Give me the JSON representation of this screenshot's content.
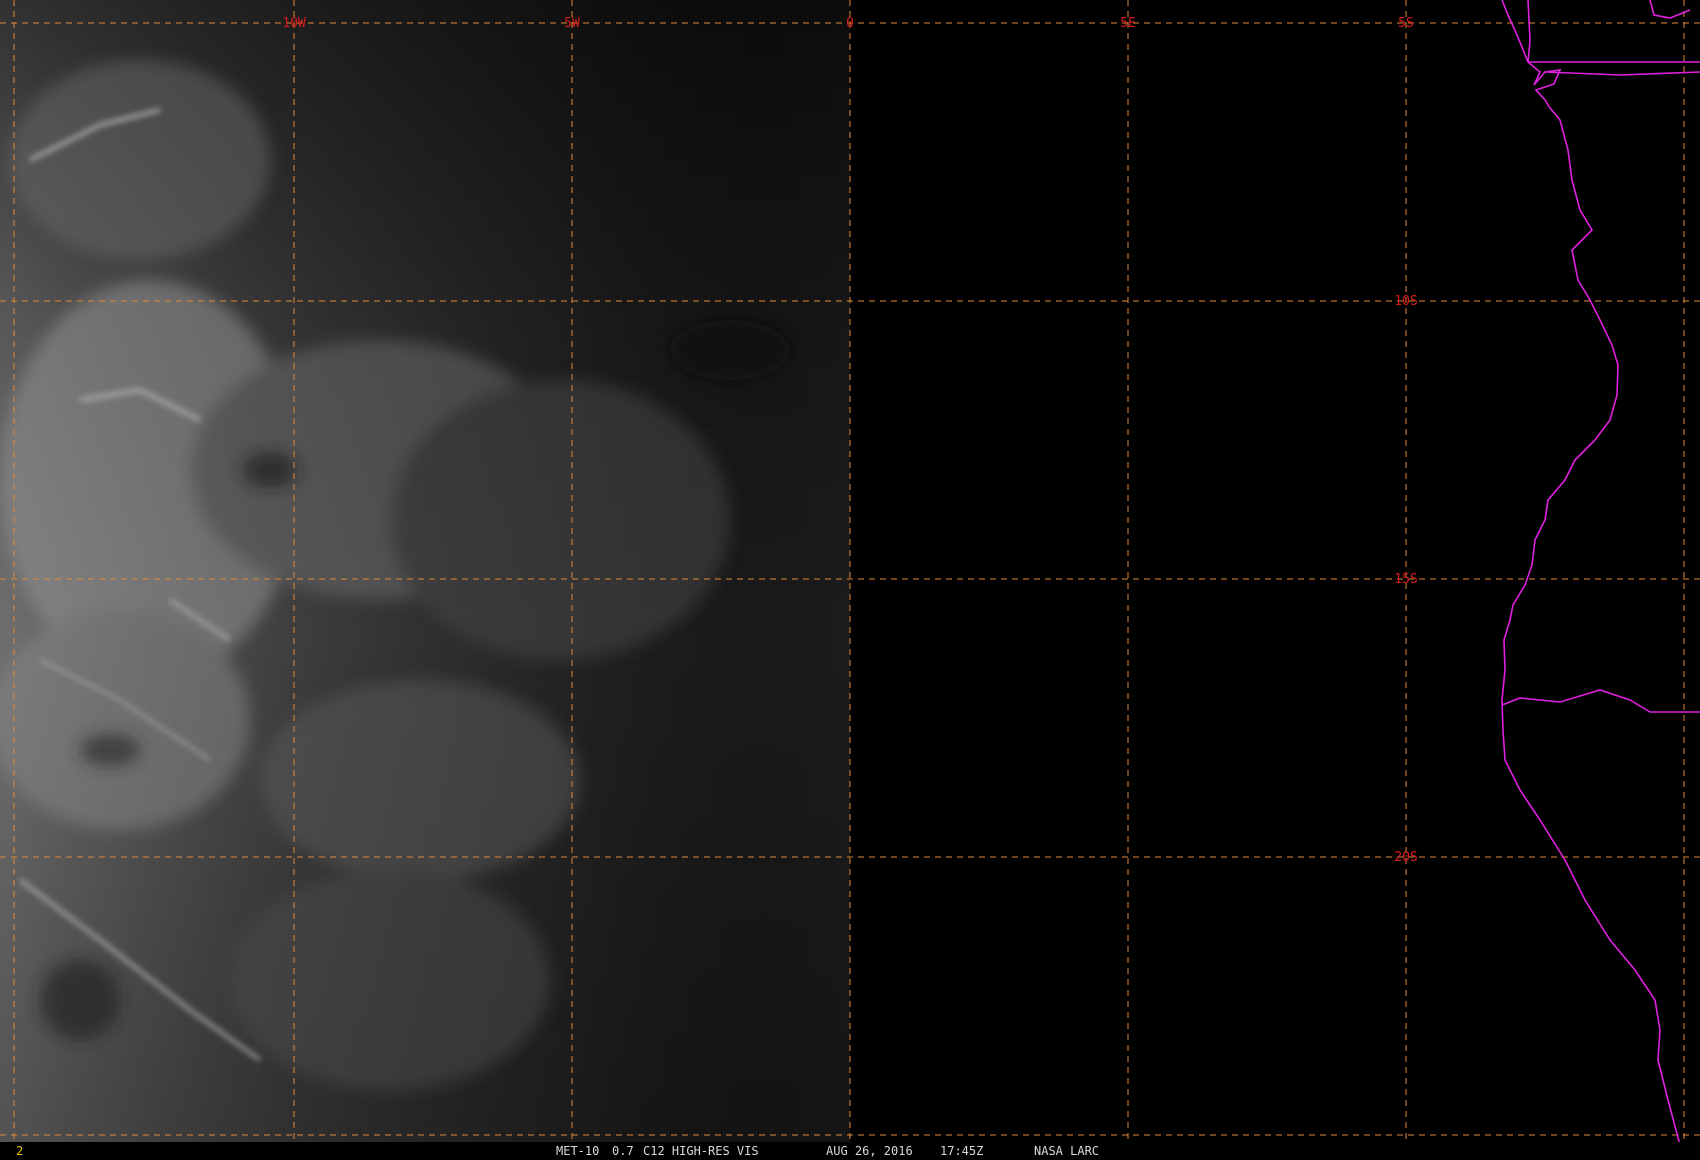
{
  "image": {
    "satellite": "MET-10",
    "wavelength": "0.7",
    "product": "C12 HIGH-RES VIS",
    "date": "AUG 26, 2016",
    "time": "17:45Z",
    "source": "NASA LARC",
    "frame_number": "2"
  },
  "grid": {
    "longitude_labels": [
      "10W",
      "5W",
      "0",
      "5E"
    ],
    "latitude_labels": [
      "5S",
      "10S",
      "15S",
      "20S"
    ]
  },
  "colors": {
    "grid_line": "#e08a3a",
    "grid_label": "#d81c1c",
    "coastline": "#e020e0",
    "background": "#000000",
    "status_text": "#d9d9d9",
    "frame_number": "#e6c200"
  }
}
